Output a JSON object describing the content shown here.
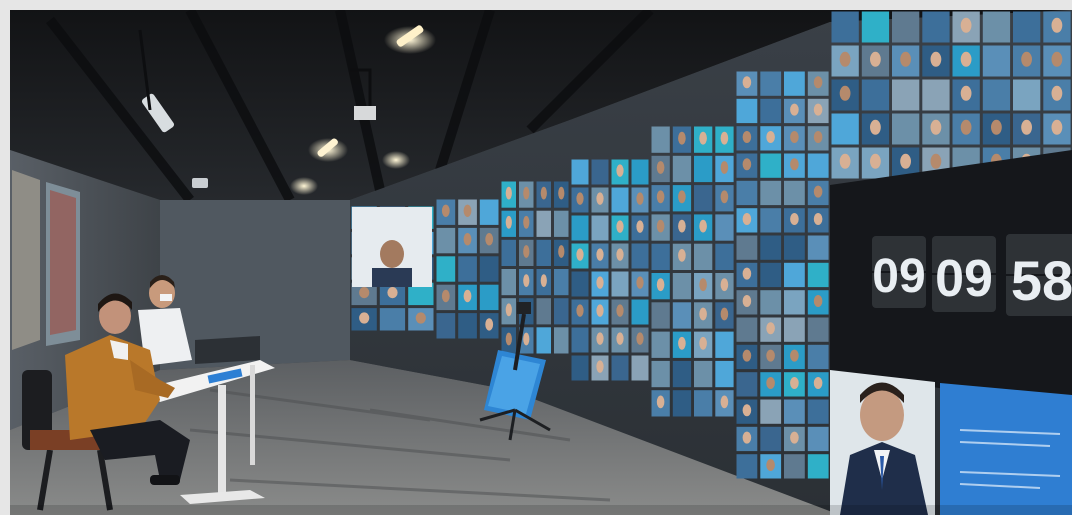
{
  "scene": {
    "clock": {
      "hours": "09",
      "minutes": "09",
      "seconds": "58"
    },
    "colors": {
      "ceiling": "#1a1b1e",
      "wall": "#4b5157",
      "floor": "#6d6f70",
      "screen_tile": "#3d6f9a",
      "screen_bright": "#4fa7d9",
      "clock_panel": "#121419",
      "jacket": "#b7782c",
      "shirt": "#e9ecef",
      "desk": "#f2f2f2"
    }
  }
}
